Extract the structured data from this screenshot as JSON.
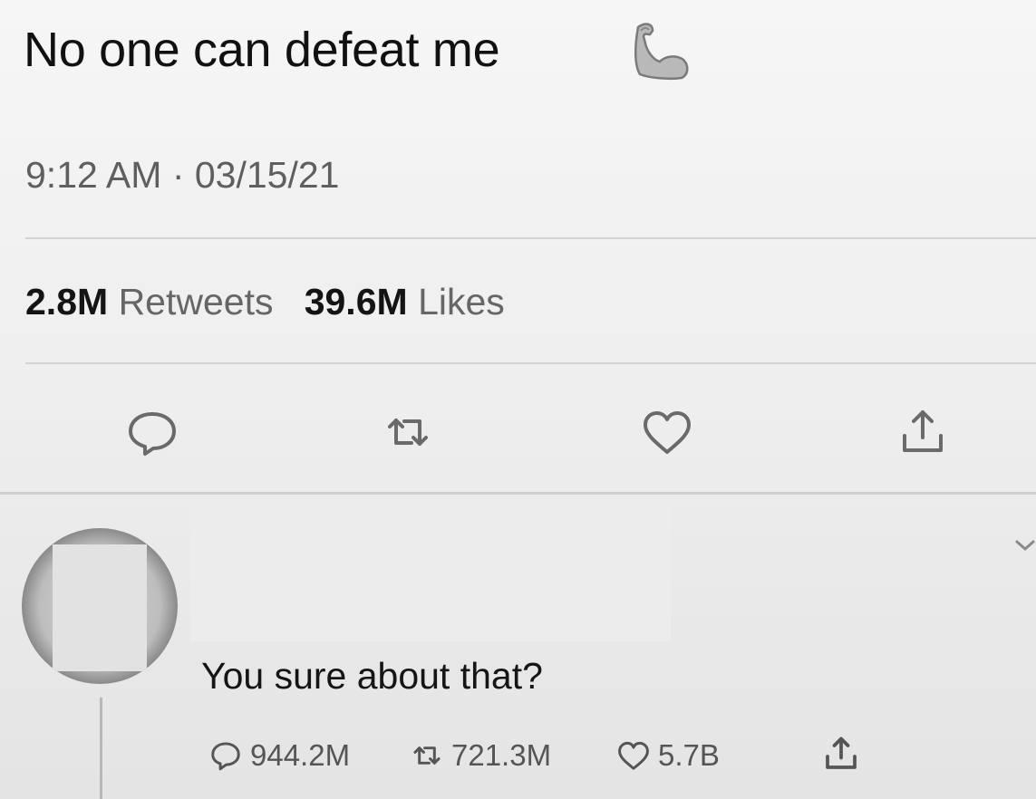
{
  "tweet": {
    "text": "No one can defeat me",
    "emoji_icon": "flexed-biceps-icon",
    "timestamp": "9:12 AM · 03/15/21",
    "retweets_count": "2.8M",
    "retweets_label": "Retweets",
    "likes_count": "39.6M",
    "likes_label": "Likes",
    "actions": [
      "reply-icon",
      "retweet-icon",
      "heart-icon",
      "share-icon"
    ]
  },
  "reply": {
    "text": "You sure about that?",
    "reply_count": "944.2M",
    "retweet_count": "721.3M",
    "like_count": "5.7B",
    "icons": [
      "reply-icon",
      "retweet-icon",
      "heart-icon",
      "share-icon",
      "chevron-down-icon"
    ]
  },
  "colors": {
    "text": "#111111",
    "muted": "#5f5f5f",
    "divider": "#d3d3d3"
  }
}
